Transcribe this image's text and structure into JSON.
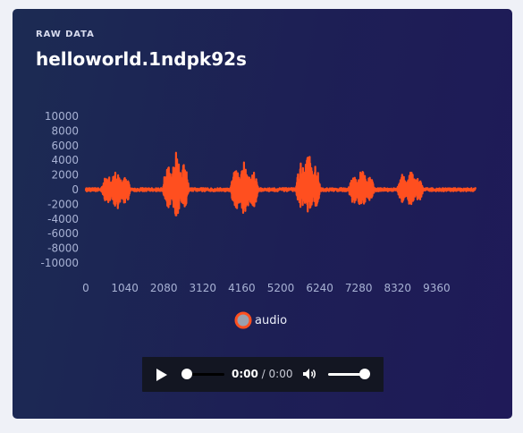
{
  "panel": {
    "kicker": "RAW DATA",
    "title": "helloworld.1ndpk92s"
  },
  "chart_data": {
    "type": "line",
    "title": "",
    "xlabel": "",
    "ylabel": "",
    "x_ticks": [
      0,
      1040,
      2080,
      3120,
      4160,
      5200,
      6240,
      7280,
      8320,
      9360
    ],
    "y_ticks": [
      10000,
      8000,
      6000,
      4000,
      2000,
      0,
      -2000,
      -4000,
      -6000,
      -8000,
      -10000
    ],
    "xlim": [
      0,
      10400
    ],
    "ylim": [
      -10000,
      10000
    ],
    "grid": false,
    "legend_position": "bottom-center",
    "series": [
      {
        "name": "audio",
        "color": "#ff4f1f",
        "legend_fill": "#9aa0ad",
        "bursts": [
          {
            "start": 400,
            "end": 1200,
            "max": 2500,
            "min": -2800
          },
          {
            "start": 2050,
            "end": 2750,
            "max": 5200,
            "min": -3600
          },
          {
            "start": 3850,
            "end": 4600,
            "max": 3800,
            "min": -3500
          },
          {
            "start": 5600,
            "end": 6250,
            "max": 4800,
            "min": -3500
          },
          {
            "start": 7000,
            "end": 7700,
            "max": 2600,
            "min": -2600
          },
          {
            "start": 8300,
            "end": 9000,
            "max": 2700,
            "min": -2300
          }
        ],
        "noise": 220
      }
    ]
  },
  "player": {
    "current_time": "0:00",
    "separator": " / ",
    "duration": "0:00",
    "progress": 0,
    "volume": 1
  },
  "icons": {
    "play": "play-icon",
    "volume": "volume-icon"
  }
}
